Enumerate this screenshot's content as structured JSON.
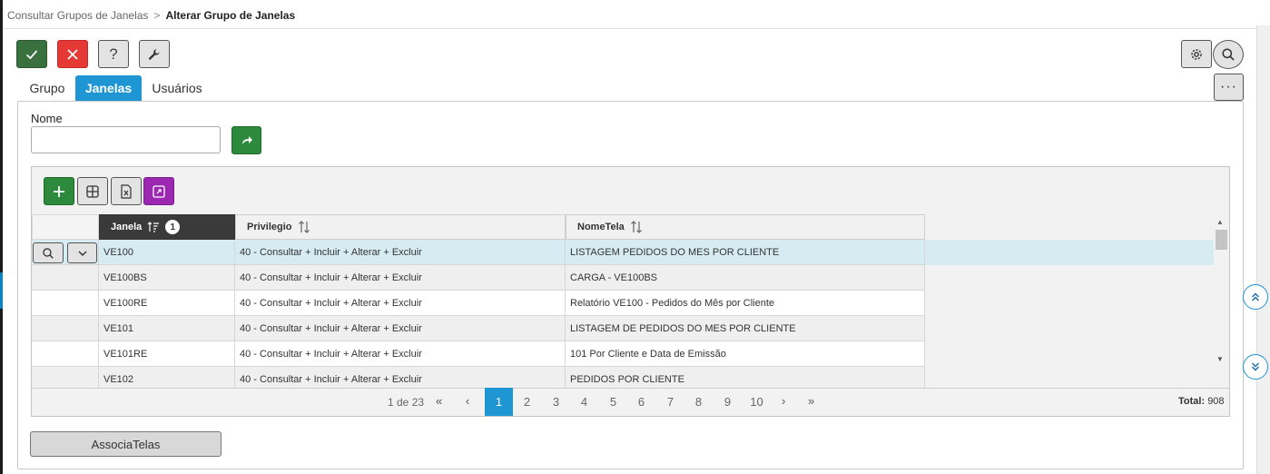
{
  "breadcrumb": {
    "parent": "Consultar Grupos de Janelas",
    "separator": ">",
    "current": "Alterar Grupo de Janelas"
  },
  "toolbar": {
    "help_label": "?",
    "more_label": "···",
    "icons": [
      "check-icon",
      "close-icon",
      "question-icon",
      "wrench-icon",
      "gear-icon",
      "search-icon"
    ]
  },
  "tabs": [
    {
      "label": "Grupo",
      "active": false
    },
    {
      "label": "Janelas",
      "active": true
    },
    {
      "label": "Usuários",
      "active": false
    }
  ],
  "form": {
    "nome_label": "Nome",
    "nome_value": ""
  },
  "grid": {
    "columns": [
      {
        "label": "Janela",
        "sort_order": "1"
      },
      {
        "label": "Privilegio"
      },
      {
        "label": "NomeTela"
      }
    ],
    "rows": [
      {
        "janela": "VE100",
        "privilegio": "40 - Consultar + Incluir + Alterar + Excluir",
        "nometela": "LISTAGEM PEDIDOS DO MES POR CLIENTE"
      },
      {
        "janela": "VE100BS",
        "privilegio": "40 - Consultar + Incluir + Alterar + Excluir",
        "nometela": "CARGA - VE100BS"
      },
      {
        "janela": "VE100RE",
        "privilegio": "40 - Consultar + Incluir + Alterar + Excluir",
        "nometela": "Relatório VE100 - Pedidos do Mês por Cliente"
      },
      {
        "janela": "VE101",
        "privilegio": "40 - Consultar + Incluir + Alterar + Excluir",
        "nometela": "LISTAGEM DE PEDIDOS DO MES POR CLIENTE"
      },
      {
        "janela": "VE101RE",
        "privilegio": "40 - Consultar + Incluir + Alterar + Excluir",
        "nometela": "101  Por Cliente e Data de Emissão"
      },
      {
        "janela": "VE102",
        "privilegio": "40 - Consultar + Incluir + Alterar + Excluir",
        "nometela": "PEDIDOS POR CLIENTE"
      }
    ],
    "pagination": {
      "info": "1 de 23",
      "first": "«",
      "prev": "‹",
      "next": "›",
      "last": "»",
      "pages": [
        "1",
        "2",
        "3",
        "4",
        "5",
        "6",
        "7",
        "8",
        "9",
        "10"
      ],
      "current_page": "1",
      "total_label": "Total:",
      "total_value": "908"
    }
  },
  "actions": {
    "associa_label": "AssociaTelas"
  },
  "colors": {
    "accent": "#1e96d3",
    "confirm": "#3a6f3e",
    "cancel": "#e53935",
    "add": "#2d8a3c",
    "expand": "#9c27b0",
    "selected_row": "#d7ecf2"
  }
}
